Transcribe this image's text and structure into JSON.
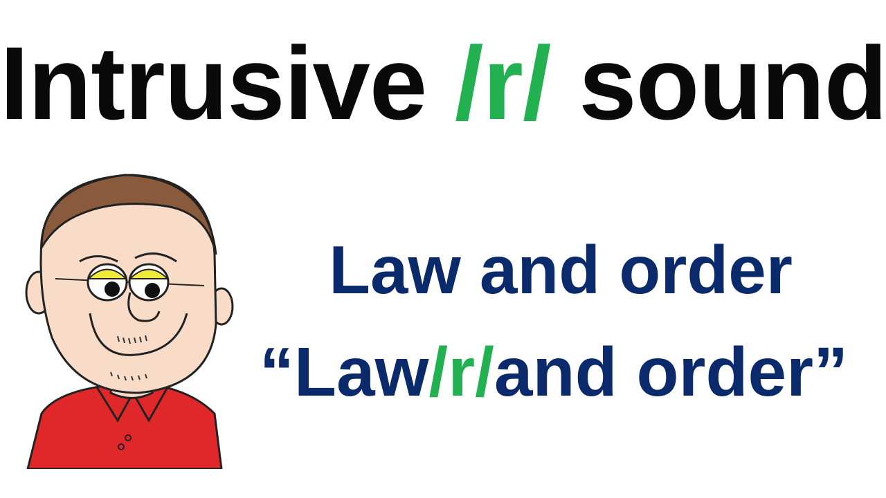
{
  "title": {
    "prefix": "Intrusive ",
    "highlight": "/r/",
    "suffix": " sound"
  },
  "phrases": {
    "line1": "Law and order",
    "line2": {
      "open_quote": "“",
      "part1": "Law",
      "highlight": "/r/",
      "part2": "and order",
      "close_quote": "”"
    }
  },
  "colors": {
    "title_text": "#0a0a0a",
    "highlight": "#22b050",
    "phrase_text": "#0b2a6b",
    "shirt": "#e0282a",
    "skin": "#f9dcc8",
    "hair": "#8a5a3c",
    "eye_lid": "#f2ea3a"
  },
  "illustration": {
    "icon": "cartoon-teacher-icon"
  }
}
